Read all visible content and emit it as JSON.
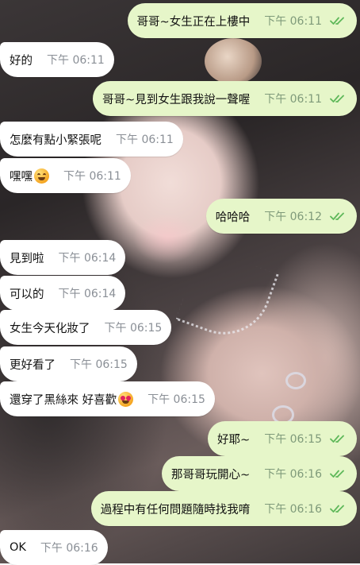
{
  "messages": [
    {
      "dir": "out",
      "text": "哥哥~女生正在上樓中",
      "time": "下午 06:11",
      "read": true
    },
    {
      "dir": "in",
      "text": "好的",
      "time": "下午 06:11"
    },
    {
      "dir": "out",
      "text": "哥哥~見到女生跟我說一聲喔",
      "time": "下午 06:11",
      "read": true
    },
    {
      "dir": "in",
      "text": "怎麼有點小緊張呢",
      "time": "下午 06:11"
    },
    {
      "dir": "in",
      "text": "嘿嘿",
      "time": "下午 06:11",
      "emoji": "grinning-face"
    },
    {
      "dir": "out",
      "text": "哈哈哈",
      "time": "下午 06:12",
      "read": true
    },
    {
      "dir": "in",
      "text": "見到啦",
      "time": "下午 06:14"
    },
    {
      "dir": "in",
      "text": "可以的",
      "time": "下午 06:14"
    },
    {
      "dir": "in",
      "text": "女生今天化妝了",
      "time": "下午 06:15"
    },
    {
      "dir": "in",
      "text": "更好看了",
      "time": "下午 06:15"
    },
    {
      "dir": "in",
      "text": "還穿了黑絲來 好喜歡",
      "time": "下午 06:15",
      "emoji": "heart-eyes-face"
    },
    {
      "dir": "out",
      "text": "好耶~",
      "time": "下午 06:15",
      "read": true
    },
    {
      "dir": "out",
      "text": "那哥哥玩開心~",
      "time": "下午 06:16",
      "read": true
    },
    {
      "dir": "out",
      "text": "過程中有任何問題隨時找我唷",
      "time": "下午 06:16",
      "read": true
    },
    {
      "dir": "in",
      "text": "OK",
      "time": "下午 06:16"
    }
  ],
  "colors": {
    "outgoing_bubble": "#e6f6c9",
    "incoming_bubble": "#ffffff",
    "read_ticks": "#5fb85a"
  }
}
